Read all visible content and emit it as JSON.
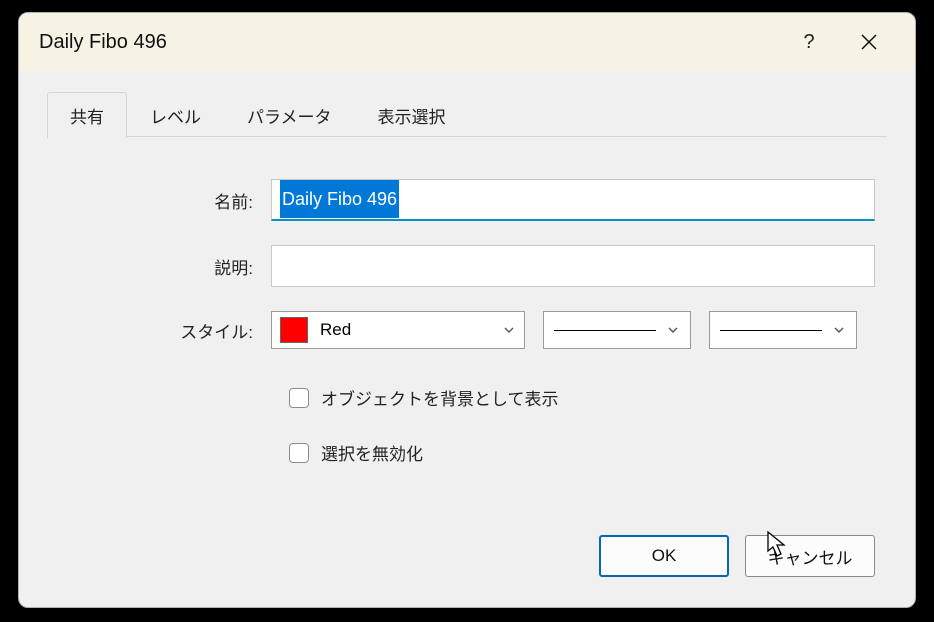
{
  "title": "Daily Fibo 496",
  "tabs": [
    "共有",
    "レベル",
    "パラメータ",
    "表示選択"
  ],
  "activeTab": 0,
  "labels": {
    "name": "名前:",
    "desc": "説明:",
    "style": "スタイル:"
  },
  "fields": {
    "nameValue": "Daily Fibo 496",
    "descValue": ""
  },
  "color": {
    "name": "Red",
    "hex": "#ff0000"
  },
  "checks": {
    "drawAsBg": "オブジェクトを背景として表示",
    "disableSel": "選択を無効化"
  },
  "buttons": {
    "ok": "OK",
    "cancel": "キャンセル"
  }
}
